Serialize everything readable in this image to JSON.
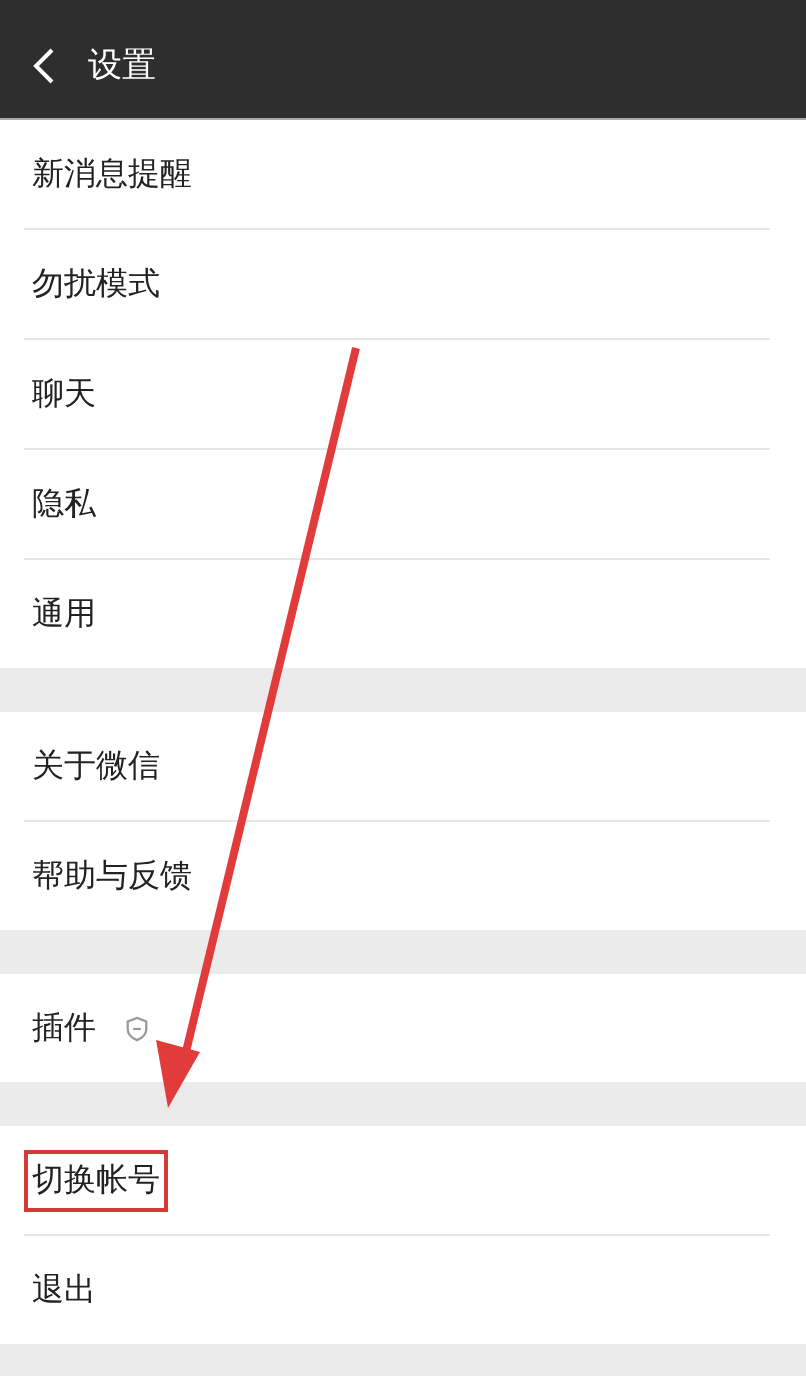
{
  "header": {
    "title": "设置"
  },
  "groups": [
    {
      "items": [
        {
          "label": "新消息提醒",
          "kind": "plain",
          "highlighted": false
        },
        {
          "label": "勿扰模式",
          "kind": "plain",
          "highlighted": false
        },
        {
          "label": "聊天",
          "kind": "plain",
          "highlighted": false
        },
        {
          "label": "隐私",
          "kind": "plain",
          "highlighted": false
        },
        {
          "label": "通用",
          "kind": "plain",
          "highlighted": false
        }
      ]
    },
    {
      "items": [
        {
          "label": "关于微信",
          "kind": "plain",
          "highlighted": false
        },
        {
          "label": "帮助与反馈",
          "kind": "plain",
          "highlighted": false
        }
      ]
    },
    {
      "items": [
        {
          "label": "插件",
          "kind": "with-icon",
          "highlighted": false
        }
      ]
    },
    {
      "items": [
        {
          "label": "切换帐号",
          "kind": "plain",
          "highlighted": true
        },
        {
          "label": "退出",
          "kind": "plain",
          "highlighted": false
        }
      ]
    }
  ]
}
